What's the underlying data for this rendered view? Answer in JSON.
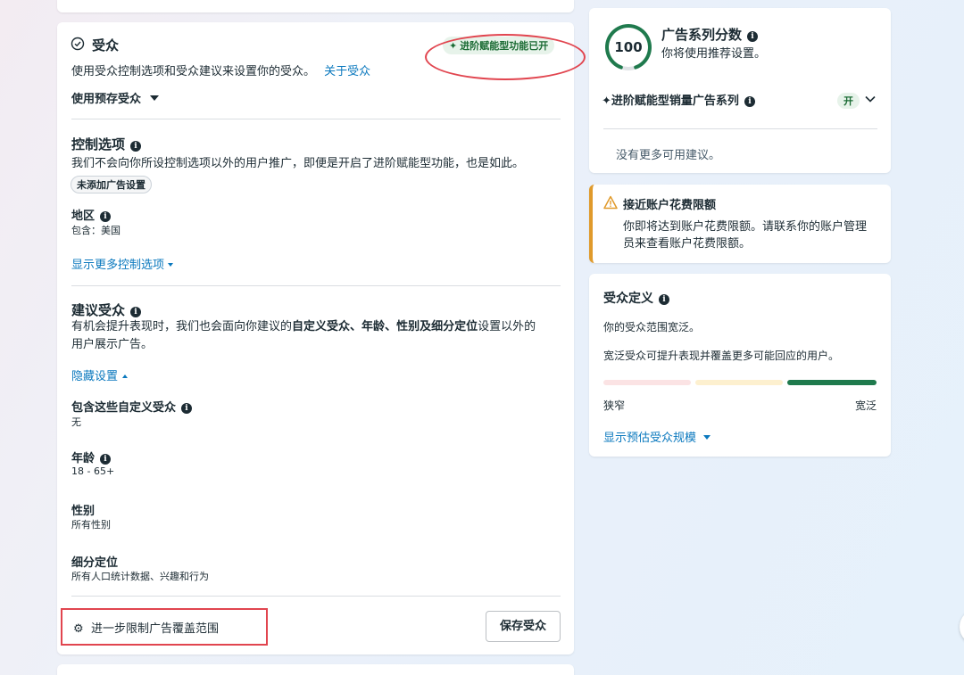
{
  "audience": {
    "title": "受众",
    "advantage_badge": "进阶赋能型功能已开",
    "description": "使用受众控制选项和受众建议来设置你的受众。",
    "about_link": "关于受众",
    "saved_audience_dropdown": "使用预存受众",
    "controls": {
      "title": "控制选项",
      "description": "我们不会向你所设控制选项以外的用户推广，即便是开启了进阶赋能型功能，也是如此。",
      "no_settings_pill": "未添加广告设置",
      "location_label": "地区",
      "location_value": "包含：美国",
      "show_more_link": "显示更多控制选项"
    },
    "suggestion": {
      "title": "建议受众",
      "desc_prefix": "有机会提升表现时，我们也会面向你建议的",
      "desc_b1": "自定义受众",
      "sep1": "、",
      "desc_b2": "年龄",
      "sep2": "、",
      "desc_b3": "性别",
      "sep3": "及",
      "desc_b4": "细分定位",
      "desc_suffix_line1": "设置以外的",
      "desc_line2": "用户展示广告。",
      "hide_link": "隐藏设置",
      "custom_audience_label": "包含这些自定义受众",
      "custom_audience_value": "无",
      "age_label": "年龄",
      "age_value": "18 - 65+",
      "gender_label": "性别",
      "gender_value": "所有性别",
      "detailed_label": "细分定位",
      "detailed_value": "所有人口统计数据、兴趣和行为"
    },
    "restrict_link": "进一步限制广告覆盖范围",
    "save_button": "保存受众"
  },
  "score_card": {
    "score": "100",
    "title": "广告系列分数",
    "subtitle": "你将使用推荐设置。",
    "advantage_campaign": "进阶赋能型销量广告系列",
    "toggle_label": "开",
    "no_more": "没有更多可用建议。",
    "score_ratio": 1.0
  },
  "warning_card": {
    "title": "接近账户花费限额",
    "body_line1": "你即将达到账户花费限额。请联系你的账户管理",
    "body_line2": "员来查看账户花费限额。"
  },
  "definition_card": {
    "title": "受众定义",
    "line1": "你的受众范围宽泛。",
    "line2": "宽泛受众可提升表现并覆盖更多可能回应的用户。",
    "narrow": "狭窄",
    "broad": "宽泛",
    "show_estimate": "显示预估受众规模"
  },
  "colors": {
    "accent_blue": "#0a78be",
    "score_green": "#1f7a4d",
    "warning_orange": "#e09a2b",
    "annotation_red": "#e1454f"
  }
}
